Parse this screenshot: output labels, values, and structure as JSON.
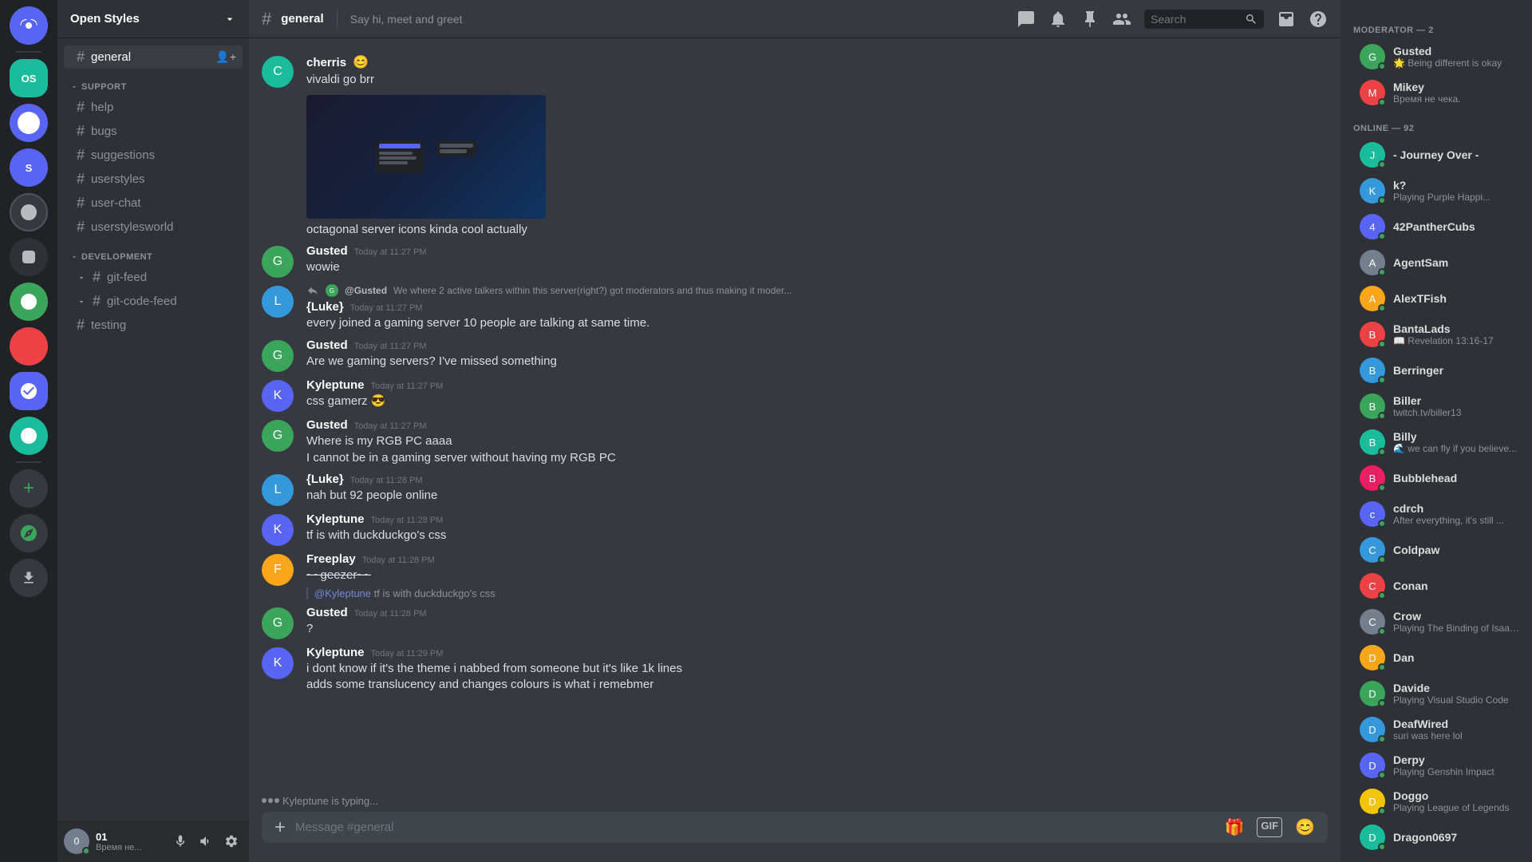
{
  "app": {
    "title": "Open Styles"
  },
  "server": {
    "name": "Open Styles",
    "channel": "general",
    "topic": "Say hi, meet and greet"
  },
  "channels": {
    "current": "general",
    "items": [
      {
        "id": "general",
        "name": "general",
        "category": null,
        "active": true
      },
      {
        "id": "support",
        "category": "SUPPORT"
      },
      {
        "id": "help",
        "name": "help",
        "category": null
      },
      {
        "id": "bugs",
        "name": "bugs",
        "category": null
      },
      {
        "id": "suggestions",
        "name": "suggestions",
        "category": null
      },
      {
        "id": "userstyles",
        "name": "userstyles",
        "category": null
      },
      {
        "id": "user-chat",
        "name": "user-chat",
        "category": null
      },
      {
        "id": "userstylesworld",
        "name": "userstylesworld",
        "category": null
      },
      {
        "id": "development",
        "category": "DEVELOPMENT"
      },
      {
        "id": "git-feed",
        "name": "git-feed",
        "category": null
      },
      {
        "id": "git-code-feed",
        "name": "git-code-feed",
        "category": null
      },
      {
        "id": "testing",
        "name": "testing",
        "category": null
      }
    ]
  },
  "messages": [
    {
      "id": "m1",
      "author": "cherris",
      "avatarColor": "av-teal",
      "avatarText": "C",
      "timestamp": "",
      "text": "vivaldi go brr",
      "hasImage": true,
      "continuation": false
    },
    {
      "id": "m2",
      "author": "",
      "text": "octagonal server icons kinda cool actually",
      "continuation": true,
      "isImageCaption": true
    },
    {
      "id": "m3",
      "author": "Gusted",
      "avatarColor": "av-green",
      "avatarText": "G",
      "timestamp": "Today at 11:27 PM",
      "text": "wowie",
      "continuation": false
    },
    {
      "id": "m4",
      "author": "{Luke}",
      "avatarColor": "av-blue",
      "avatarText": "L",
      "timestamp": "Today at 11:27 PM",
      "text": "every joined a gaming server 10 people are talking at same time.",
      "continuation": false,
      "hasReply": true,
      "replyAuthor": "@Gusted",
      "replyText": "We where 2 active talkers within this server(right?) got moderators and thus making it moder..."
    },
    {
      "id": "m5",
      "author": "Gusted",
      "avatarColor": "av-green",
      "avatarText": "G",
      "timestamp": "Today at 11:27 PM",
      "text": "Are we gaming servers? I've missed something",
      "continuation": false
    },
    {
      "id": "m6",
      "author": "Kyleptune",
      "avatarColor": "av-purple",
      "avatarText": "K",
      "timestamp": "Today at 11:27 PM",
      "text": "css gamerz 😎",
      "continuation": false
    },
    {
      "id": "m7",
      "author": "Gusted",
      "avatarColor": "av-green",
      "avatarText": "G",
      "timestamp": "Today at 11:27 PM",
      "text": "Where is my RGB PC aaaa",
      "continuation": false
    },
    {
      "id": "m8",
      "author": "",
      "text": "I cannot be in a gaming server without having my RGB PC",
      "continuation": true
    },
    {
      "id": "m9",
      "author": "{Luke}",
      "avatarColor": "av-blue",
      "avatarText": "L",
      "timestamp": "Today at 11:28 PM",
      "text": "nah but 92 people online",
      "continuation": false
    },
    {
      "id": "m10",
      "author": "Kyleptune",
      "avatarColor": "av-purple",
      "avatarText": "K",
      "timestamp": "Today at 11:28 PM",
      "text": "tf is with duckduckgo's css",
      "continuation": false
    },
    {
      "id": "m11",
      "author": "Freeplay",
      "avatarColor": "av-orange",
      "avatarText": "F",
      "timestamp": "Today at 11:28 PM",
      "text": "~~geezer~~",
      "isStrikethrough": true,
      "continuation": false
    },
    {
      "id": "m12",
      "author": "",
      "text": "@Kyleptune tf is with duckduckgo's css",
      "continuation": true,
      "isReplyQuote": true
    },
    {
      "id": "m13",
      "author": "Gusted",
      "avatarColor": "av-green",
      "avatarText": "G",
      "timestamp": "Today at 11:28 PM",
      "text": "?",
      "continuation": false
    },
    {
      "id": "m14",
      "author": "Kyleptune",
      "avatarColor": "av-purple",
      "avatarText": "K",
      "timestamp": "Today at 11:29 PM",
      "text": "i dont know if it's the theme i nabbed from someone but it's like 1k lines",
      "continuation": false
    },
    {
      "id": "m15",
      "author": "",
      "text": "adds some translucency and changes colours is what i remebmer",
      "continuation": true
    }
  ],
  "typing": {
    "text": "Kyleptune is typing..."
  },
  "messageInput": {
    "placeholder": "Message #general"
  },
  "members": {
    "moderatorCount": 2,
    "onlineCount": 92,
    "moderators": [
      {
        "name": "Gusted",
        "status": "Being different is okay",
        "statusType": "online",
        "avatarColor": "av-green",
        "avatarText": "G"
      },
      {
        "name": "Mikey",
        "status": "Время не чека.",
        "statusType": "online",
        "avatarColor": "av-red",
        "avatarText": "M"
      }
    ],
    "online": [
      {
        "name": "- Journey Over -",
        "status": "",
        "statusType": "online",
        "avatarColor": "av-teal",
        "avatarText": "J"
      },
      {
        "name": "k?",
        "status": "Playing Purple Happi...",
        "statusType": "online",
        "avatarColor": "av-blue",
        "avatarText": "K"
      },
      {
        "name": "42PantherCubs",
        "status": "",
        "statusType": "online",
        "avatarColor": "av-purple",
        "avatarText": "4"
      },
      {
        "name": "AgentSam",
        "status": "",
        "statusType": "online",
        "avatarColor": "av-gray",
        "avatarText": "A"
      },
      {
        "name": "AlexTFish",
        "status": "",
        "statusType": "online",
        "avatarColor": "av-orange",
        "avatarText": "A"
      },
      {
        "name": "BantaLads",
        "status": "Revelation 13:16-17",
        "statusType": "online",
        "avatarColor": "av-red",
        "avatarText": "B"
      },
      {
        "name": "Berringer",
        "status": "",
        "statusType": "online",
        "avatarColor": "av-blue",
        "avatarText": "B"
      },
      {
        "name": "Biller",
        "status": "twitch.tv/biller13",
        "statusType": "online",
        "avatarColor": "av-green",
        "avatarText": "B"
      },
      {
        "name": "Billy",
        "status": "🌊 we can fly if you believe...",
        "statusType": "online",
        "avatarColor": "av-teal",
        "avatarText": "B"
      },
      {
        "name": "Bubblehead",
        "status": "",
        "statusType": "online",
        "avatarColor": "av-pink",
        "avatarText": "B"
      },
      {
        "name": "cdrch",
        "status": "After everything, it's still ...",
        "statusType": "online",
        "avatarColor": "av-purple",
        "avatarText": "c"
      },
      {
        "name": "Coldpaw",
        "status": "",
        "statusType": "online",
        "avatarColor": "av-blue",
        "avatarText": "C"
      },
      {
        "name": "Conan",
        "status": "",
        "statusType": "online",
        "avatarColor": "av-red",
        "avatarText": "C"
      },
      {
        "name": "Crow",
        "status": "Playing The Binding of Isaac...",
        "statusType": "online",
        "avatarColor": "av-gray",
        "avatarText": "C"
      },
      {
        "name": "Dan",
        "status": "",
        "statusType": "online",
        "avatarColor": "av-orange",
        "avatarText": "D"
      },
      {
        "name": "Davide",
        "status": "Playing Visual Studio Code",
        "statusType": "online",
        "avatarColor": "av-green",
        "avatarText": "D"
      },
      {
        "name": "DeafWired",
        "status": "suri was here lol",
        "statusType": "online",
        "avatarColor": "av-blue",
        "avatarText": "D"
      },
      {
        "name": "Derpy",
        "status": "Playing Genshin Impact",
        "statusType": "online",
        "avatarColor": "av-purple",
        "avatarText": "D"
      },
      {
        "name": "Doggo",
        "status": "Playing League of Legends",
        "statusType": "online",
        "avatarColor": "av-yellow",
        "avatarText": "D"
      },
      {
        "name": "Dragon0697",
        "status": "",
        "statusType": "online",
        "avatarColor": "av-teal",
        "avatarText": "D"
      }
    ]
  },
  "search": {
    "placeholder": "Search",
    "label": "Search"
  },
  "currentUser": {
    "name": "01",
    "status": "Время не...",
    "avatarText": "0"
  }
}
